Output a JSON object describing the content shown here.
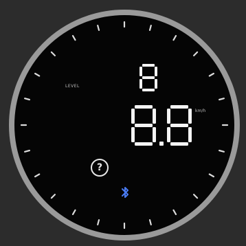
{
  "display": {
    "level_label": "LEVEL",
    "level_value": "8",
    "main_value": "8.8",
    "unit_label": "km/h"
  },
  "colors": {
    "background": "#2c2c2c",
    "bezel": "#9a9a9a",
    "face": "#050505",
    "digits": "#f4f4f4",
    "ticks": "#dcdcdc",
    "bluetooth": "#4a7cf5"
  },
  "icons": {
    "help": "help-icon",
    "bluetooth": "bluetooth-icon"
  }
}
